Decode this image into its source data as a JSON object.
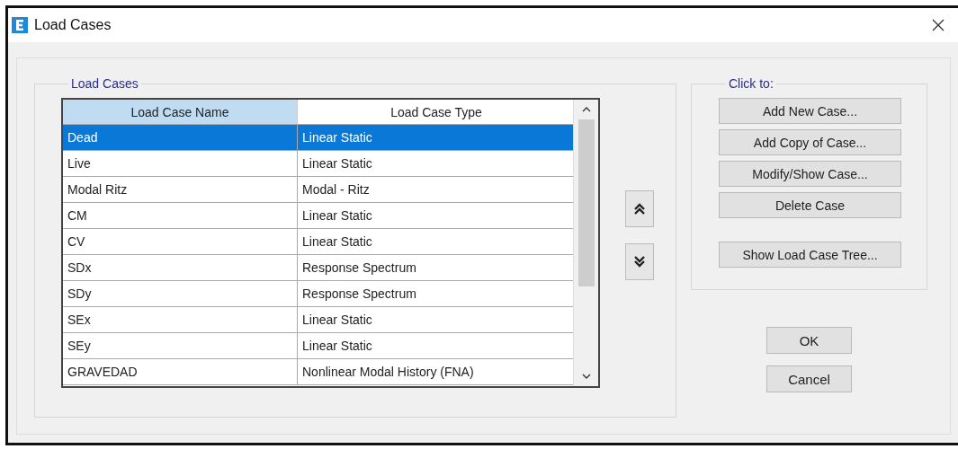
{
  "window": {
    "title": "Load Cases"
  },
  "group": {
    "title": "Load Cases"
  },
  "table": {
    "columns": [
      {
        "label": "Load Case Name",
        "highlighted": true
      },
      {
        "label": "Load Case Type",
        "highlighted": false
      }
    ],
    "rows": [
      {
        "name": "Dead",
        "type": "Linear Static",
        "selected": true
      },
      {
        "name": "Live",
        "type": "Linear Static",
        "selected": false
      },
      {
        "name": "Modal Ritz",
        "type": "Modal - Ritz",
        "selected": false
      },
      {
        "name": "CM",
        "type": "Linear Static",
        "selected": false
      },
      {
        "name": "CV",
        "type": "Linear Static",
        "selected": false
      },
      {
        "name": "SDx",
        "type": "Response Spectrum",
        "selected": false
      },
      {
        "name": "SDy",
        "type": "Response Spectrum",
        "selected": false
      },
      {
        "name": "SEx",
        "type": "Linear Static",
        "selected": false
      },
      {
        "name": "SEy",
        "type": "Linear Static",
        "selected": false
      },
      {
        "name": "GRAVEDAD",
        "type": "Nonlinear Modal History (FNA)",
        "selected": false
      }
    ]
  },
  "actions": {
    "title": "Click to:",
    "buttons": [
      "Add New Case...",
      "Add Copy of Case...",
      "Modify/Show Case...",
      "Delete Case",
      "Show Load Case Tree..."
    ]
  },
  "dialog_buttons": [
    "OK",
    "Cancel"
  ]
}
